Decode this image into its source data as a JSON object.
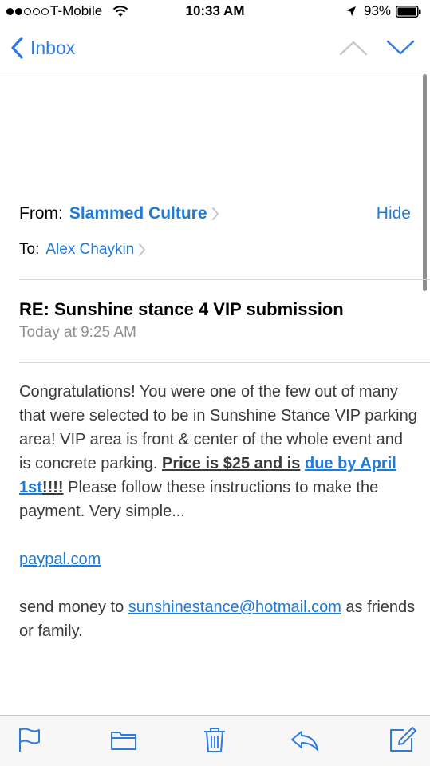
{
  "status_bar": {
    "carrier": "T-Mobile",
    "time": "10:33 AM",
    "battery": "93%",
    "signal_bars_filled": 2,
    "signal_bars_total": 5
  },
  "nav": {
    "back_label": "Inbox"
  },
  "header": {
    "from_label": "From:",
    "sender": "Slammed Culture",
    "hide_label": "Hide",
    "to_label": "To:",
    "recipient": "Alex Chaykin",
    "subject": "RE: Sunshine stance 4 VIP submission",
    "date": "Today at 9:25 AM"
  },
  "body": {
    "intro": "Congratulations! You were one of the few out of many that were selected to be in Sunshine Stance VIP parking area! VIP area is front & center of the whole event and is concrete parking. ",
    "price": "Price is $25 and is",
    "due": "due by April 1st",
    "exclaim": "!!!!",
    "instructions": " Please follow these instructions to make the payment. Very simple...",
    "paypal": "paypal.com",
    "send_prefix": "send money to ",
    "email": "sunshinestance@hotmail.com",
    "send_suffix": " as friends or family."
  },
  "toolbar": {
    "icons": [
      "flag-icon",
      "folder-icon",
      "trash-icon",
      "reply-icon",
      "compose-icon"
    ]
  },
  "colors": {
    "accent": "#1f7ad8",
    "text": "#3a3a3a",
    "secondary": "#8e8e93"
  }
}
